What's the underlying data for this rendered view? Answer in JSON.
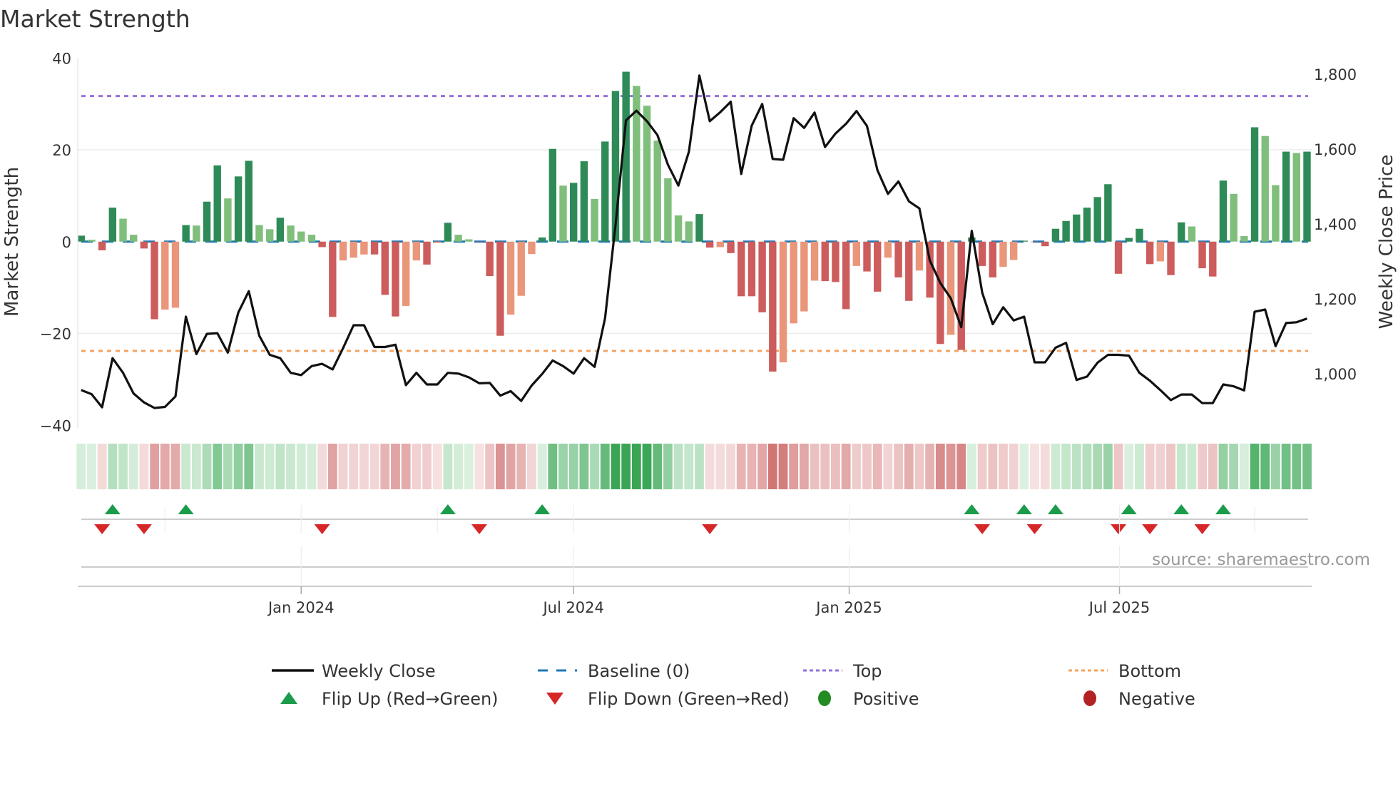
{
  "chart_data": {
    "type": "bar",
    "title": "Market Strength",
    "ylabel": "Market Strength",
    "y2label": "Weekly Close Price",
    "ylim": [
      -40,
      40
    ],
    "y2lim": [
      857,
      1905
    ],
    "yticks": [
      "40",
      "20",
      "0",
      "−20",
      "−40"
    ],
    "ytick_values": [
      40,
      20,
      0,
      -20,
      -40
    ],
    "y2ticks": [
      "1,800",
      "1,600",
      "1,400",
      "1,200",
      "1,000"
    ],
    "y2tick_values": [
      1800,
      1600,
      1400,
      1200,
      1000
    ],
    "xticks": [
      "Jan 2024",
      "Jul 2024",
      "Jan 2025",
      "Jul 2025"
    ],
    "xtick_week_index": [
      21,
      47,
      73.3,
      99.1
    ],
    "frequency": "weekly",
    "grid": true,
    "top_level": 31.7,
    "bottom_level": -23.8,
    "baseline": 0,
    "strength": [
      1.3,
      0.4,
      -1.9,
      7.4,
      5.0,
      1.5,
      -1.5,
      -16.9,
      -14.8,
      -14.4,
      3.6,
      3.5,
      8.7,
      16.6,
      9.4,
      14.2,
      17.6,
      3.6,
      2.7,
      5.2,
      3.5,
      2.2,
      1.5,
      -1.2,
      -16.4,
      -4.1,
      -3.5,
      -2.8,
      -2.8,
      -11.6,
      -16.3,
      -14.0,
      -4.1,
      -5.0,
      -0.3,
      4.1,
      1.5,
      0.5,
      -0.1,
      -7.5,
      -20.5,
      -15.9,
      -11.8,
      -2.7,
      0.9,
      20.2,
      12.2,
      12.8,
      17.5,
      9.3,
      21.8,
      32.8,
      37.0,
      33.9,
      29.6,
      22.0,
      13.8,
      5.7,
      4.4,
      6.0,
      -1.3,
      -1.2,
      -2.5,
      -11.9,
      -11.9,
      -15.4,
      -28.3,
      -26.3,
      -17.8,
      -15.2,
      -8.5,
      -8.6,
      -8.8,
      -14.7,
      -5.3,
      -6.5,
      -10.9,
      -3.5,
      -7.8,
      -12.9,
      -6.3,
      -12.2,
      -22.3,
      -20.3,
      -23.6,
      0.9,
      -5.3,
      -7.8,
      -5.5,
      -4.0,
      0.2,
      -0.1,
      -1.0,
      2.8,
      4.5,
      5.9,
      7.4,
      9.7,
      12.5,
      -7.0,
      0.8,
      2.8,
      -4.9,
      -4.3,
      -7.3,
      4.2,
      3.3,
      -5.8,
      -7.6,
      13.3,
      10.4,
      1.2,
      24.9,
      23.0,
      12.3,
      19.6,
      19.3,
      19.6
    ],
    "weekly_close": [
      956,
      945,
      910,
      1041,
      1002,
      947,
      923,
      908,
      911,
      939,
      1152,
      1052,
      1106,
      1108,
      1056,
      1163,
      1220,
      1101,
      1050,
      1041,
      1002,
      996,
      1020,
      1026,
      1011,
      1068,
      1129,
      1129,
      1071,
      1071,
      1077,
      969,
      1002,
      971,
      971,
      1002,
      1000,
      990,
      974,
      975,
      941,
      953,
      927,
      968,
      999,
      1035,
      1020,
      1000,
      1041,
      1018,
      1148,
      1396,
      1676,
      1702,
      1674,
      1637,
      1558,
      1502,
      1592,
      1796,
      1674,
      1698,
      1726,
      1533,
      1662,
      1720,
      1573,
      1571,
      1682,
      1656,
      1697,
      1605,
      1641,
      1667,
      1701,
      1661,
      1543,
      1480,
      1513,
      1460,
      1441,
      1302,
      1242,
      1201,
      1124,
      1381,
      1216,
      1132,
      1177,
      1142,
      1152,
      1030,
      1030,
      1069,
      1082,
      983,
      992,
      1029,
      1050,
      1050,
      1048,
      1002,
      981,
      956,
      929,
      944,
      944,
      921,
      921,
      971,
      966,
      955,
      1165,
      1171,
      1073,
      1135,
      1137,
      1147
    ],
    "flip_up_week_index": [
      3,
      10,
      35,
      44,
      85,
      90,
      93,
      100,
      105,
      109
    ],
    "flip_down_week_index": [
      2,
      6,
      23,
      38,
      60,
      86,
      91,
      99,
      102,
      107
    ],
    "legend_position": "bottom",
    "legend": [
      {
        "label": "Weekly Close",
        "kind": "line"
      },
      {
        "label": "Baseline (0)",
        "kind": "dash"
      },
      {
        "label": "Top",
        "kind": "dot-purple"
      },
      {
        "label": "Bottom",
        "kind": "dot-orange"
      },
      {
        "label": "Flip Up (Red→Green)",
        "kind": "tri-up"
      },
      {
        "label": "Flip Down (Green→Red)",
        "kind": "tri-down"
      },
      {
        "label": "Positive",
        "kind": "circle-green"
      },
      {
        "label": "Negative",
        "kind": "circle-red"
      }
    ],
    "colors": {
      "pos_strong": "#2e8b57",
      "pos_weak": "#7fbf7b",
      "neg_strong": "#cd5c5c",
      "neg_weak": "#e9967a",
      "baseline": "#1f77b4",
      "top": "#9370db",
      "bottom": "#f4a460",
      "line": "#111111",
      "flip_up": "#1a9c4a",
      "flip_down": "#d62728",
      "positive": "#228b22",
      "negative": "#b22222"
    }
  },
  "source": "source: sharemaestro.com"
}
